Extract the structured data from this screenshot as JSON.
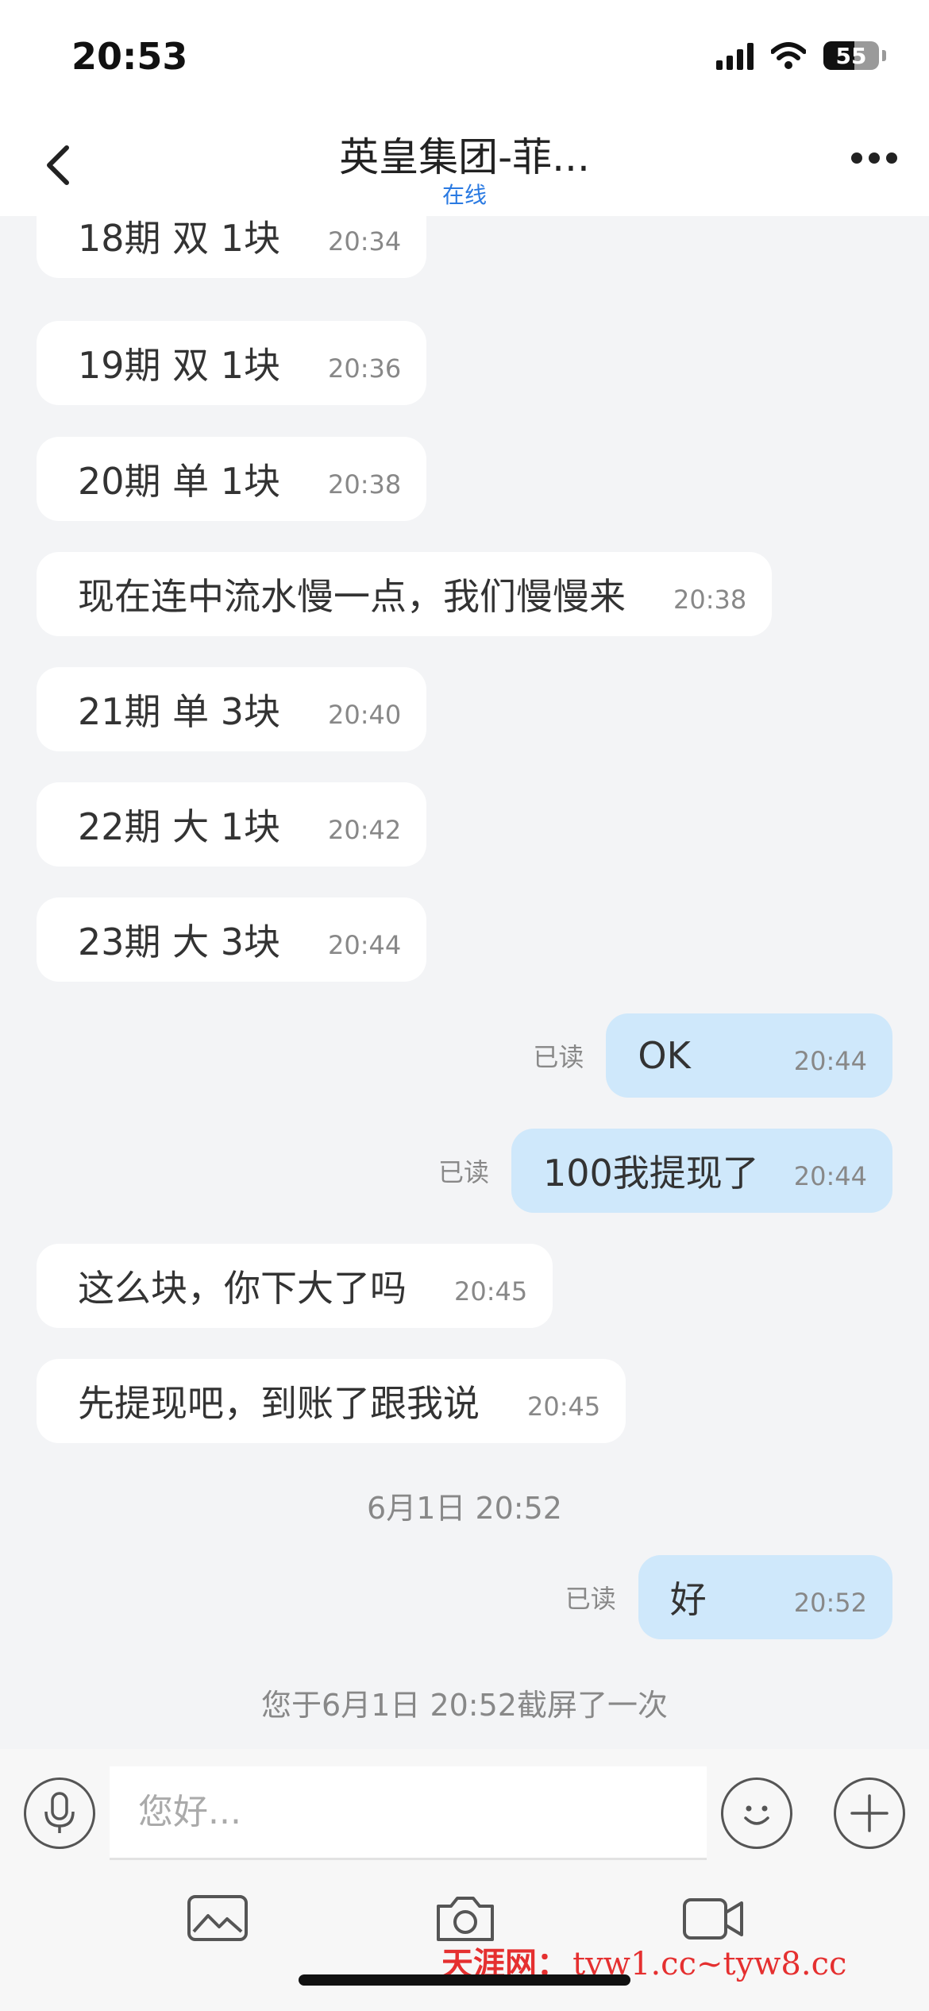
{
  "status_bar": {
    "time": "20:53",
    "battery": "55",
    "battery_level": 0.55
  },
  "nav": {
    "title": "英皇集团-菲...",
    "subtitle": "在线"
  },
  "messages": [
    {
      "text": "18期  双  1块",
      "time": "20:34"
    },
    {
      "text": "19期  双 1块",
      "time": "20:36"
    },
    {
      "text": "20期  单  1块",
      "time": "20:38"
    },
    {
      "text": "现在连中流水慢一点，我们慢慢来",
      "time": "20:38"
    },
    {
      "text": "21期  单  3块",
      "time": "20:40"
    },
    {
      "text": "22期 大 1块",
      "time": "20:42"
    },
    {
      "text": "23期  大 3块",
      "time": "20:44"
    },
    {
      "text": "OK",
      "time": "20:44",
      "status": "已读"
    },
    {
      "text": "100我提现了",
      "time": "20:44",
      "status": "已读"
    },
    {
      "text": "这么块，你下大了吗",
      "time": "20:45"
    },
    {
      "text": "先提现吧，到账了跟我说",
      "time": "20:45"
    },
    {
      "text": "好",
      "time": "20:52",
      "status": "已读"
    }
  ],
  "date_divider": "6月1日 20:52",
  "screenshot_notice": "您于6月1日 20:52截屏了一次",
  "input": {
    "placeholder": "您好..."
  },
  "watermark": {
    "site": "天涯网：",
    "url": "tyw1.cc~tyw8.cc"
  }
}
